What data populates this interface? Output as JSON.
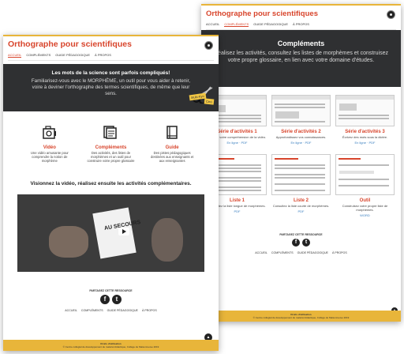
{
  "back_page": {
    "header": {
      "title": "Orthographe pour scientifiques"
    },
    "nav": [
      "ACCUEIL",
      "COMPLÉMENTS",
      "GUIDE PÉDAGOGIQUE",
      "À PROPOS"
    ],
    "nav_active_index": 1,
    "hero": {
      "title": "Compléments",
      "subtitle": "Réalisez les activités, consultez les listes de morphèmes et construisez votre propre glossaire, en lien avec votre domaine d'études."
    },
    "cards": [
      {
        "title": "Série d'activités 1",
        "desc": "Vérifiez votre compréhension de la vidéo.",
        "link": "En ligne · PDF"
      },
      {
        "title": "Série d'activités 2",
        "desc": "Approfondissez vos connaissances.",
        "link": "En ligne · PDF"
      },
      {
        "title": "Série d'activités 3",
        "desc": "Écrivez des mots sous la dictée.",
        "link": "En ligne · PDF"
      },
      {
        "title": "Liste 1",
        "desc": "Consultez la liste longue de morphèmes.",
        "link": "PDF"
      },
      {
        "title": "Liste 2",
        "desc": "Consultez la liste courte de morphèmes.",
        "link": "PDF"
      },
      {
        "title": "Outil",
        "desc": "Construisez votre propre liste de morphèmes.",
        "link": "WORD"
      }
    ],
    "share_title": "PARTAGEZ CETTE RESSOURCE",
    "footer_nav": [
      "ACCUEIL",
      "COMPLÉMENTS",
      "GUIDE PÉDAGOGIQUE",
      "À PROPOS"
    ],
    "footer_line1": "Droits d'utilisation",
    "footer_line2": "© Centre collégial de développement de matériel didactique, Collège de Maisonneuve 2019"
  },
  "front_page": {
    "header": {
      "title": "Orthographe pour scientifiques"
    },
    "nav": [
      "ACCUEIL",
      "COMPLÉMENTS",
      "GUIDE PÉDAGOGIQUE",
      "À PROPOS"
    ],
    "nav_active_index": 0,
    "hero": {
      "title": "Les mots de la science sont parfois compliqués!",
      "subtitle": "Familiarisez-vous avec le MORPHÈME, un outil pour vous aider à retenir, voire à deviner l'orthographe des termes scientifiques, de même que leur sens.",
      "tag1": "Multi-Kyo",
      "tag2": "Ceci"
    },
    "features": [
      {
        "title": "Vidéo",
        "desc": "Une vidéo amusante pour comprendre la notion de morphème",
        "icon": "camera-icon"
      },
      {
        "title": "Compléments",
        "desc": "Des activités, des listes de morphèmes et un outil pour construire votre propre glossaire",
        "icon": "documents-icon"
      },
      {
        "title": "Guide",
        "desc": "Des pistes pédagogiques destinées aux enseignants et aux enseignantes",
        "icon": "book-icon"
      }
    ],
    "video_heading": "Visionnez la vidéo, réalisez ensuite les activités complémentaires.",
    "video_text": "AU SECOURS",
    "share_title": "PARTAGEZ CETTE RESSOURCE",
    "footer_nav": [
      "ACCUEIL",
      "COMPLÉMENTS",
      "GUIDE PÉDAGOGIQUE",
      "À PROPOS"
    ],
    "footer_line1": "Droits d'utilisation",
    "footer_line2": "© Centre collégial de développement de matériel didactique, Collège de Maisonneuve 2019"
  },
  "colors": {
    "accent": "#d8452c",
    "gold": "#e8b53a",
    "hero_bg": "#2f3032",
    "link": "#3a7fc0"
  }
}
